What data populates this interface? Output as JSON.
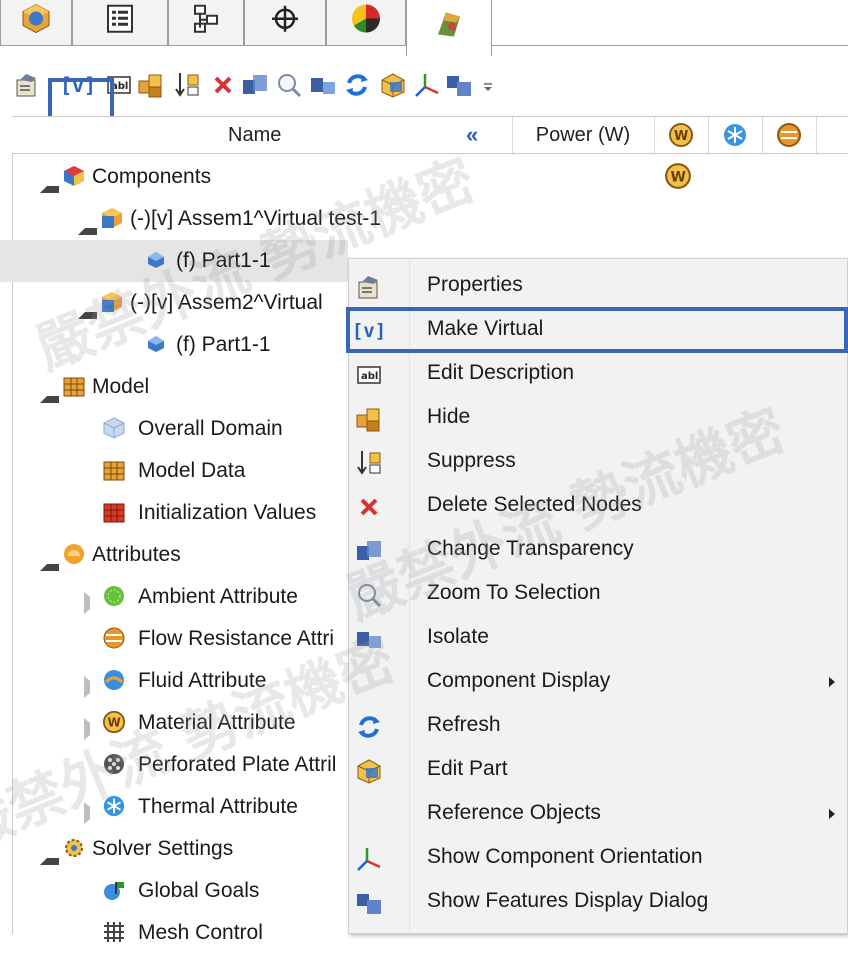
{
  "tabs": [
    {
      "icon": "component-tree-icon"
    },
    {
      "icon": "list-icon"
    },
    {
      "icon": "assembly-icon"
    },
    {
      "icon": "crosshair-icon"
    },
    {
      "icon": "pie-chart-icon"
    },
    {
      "icon": "simulation-icon"
    }
  ],
  "toolbar": {
    "icons": [
      "properties-icon",
      "make-virtual-icon",
      "edit-description-icon",
      "hide-icon",
      "suppress-icon",
      "delete-icon",
      "transparency-icon",
      "zoom-selection-icon",
      "isolate-icon",
      "refresh-icon",
      "edit-part-icon",
      "orientation-icon",
      "features-display-icon",
      "overflow-icon"
    ],
    "virtual_label": "[v]"
  },
  "header": {
    "name": "Name",
    "collapse": "«",
    "power": "Power (W)"
  },
  "tree": [
    {
      "label": "Components",
      "level": 0,
      "expanded": true
    },
    {
      "label": "(-)[v] Assem1^Virtual test-1",
      "level": 1,
      "expanded": true
    },
    {
      "label": "(f) Part1-1",
      "level": 2,
      "selected": true
    },
    {
      "label": "(-)[v] Assem2^Virtual",
      "level": 1,
      "expanded": true
    },
    {
      "label": "(f) Part1-1",
      "level": 2
    },
    {
      "label": "Model",
      "level": 0,
      "expanded": true
    },
    {
      "label": "Overall Domain",
      "level": 1
    },
    {
      "label": "Model Data",
      "level": 1
    },
    {
      "label": "Initialization Values",
      "level": 1
    },
    {
      "label": "Attributes",
      "level": 0,
      "expanded": true
    },
    {
      "label": "Ambient Attribute",
      "level": 1,
      "collapsed": true
    },
    {
      "label": "Flow Resistance Attri",
      "level": 1
    },
    {
      "label": "Fluid Attribute",
      "level": 1,
      "collapsed": true
    },
    {
      "label": "Material Attribute",
      "level": 1,
      "collapsed": true
    },
    {
      "label": "Perforated Plate Attril",
      "level": 1
    },
    {
      "label": "Thermal Attribute",
      "level": 1,
      "collapsed": true
    },
    {
      "label": "Solver Settings",
      "level": 0,
      "expanded": true
    },
    {
      "label": "Global Goals",
      "level": 1
    },
    {
      "label": "Mesh Control",
      "level": 1
    }
  ],
  "menu": [
    {
      "label": "Properties",
      "icon": "properties-icon"
    },
    {
      "label": "Make Virtual",
      "icon": "make-virtual-icon",
      "icon_text": "[v]",
      "highlighted": true
    },
    {
      "label": "Edit Description",
      "icon": "edit-description-icon",
      "icon_text": "abl"
    },
    {
      "label": "Hide",
      "icon": "hide-icon"
    },
    {
      "label": "Suppress",
      "icon": "suppress-icon"
    },
    {
      "label": "Delete Selected Nodes",
      "icon": "delete-icon"
    },
    {
      "label": "Change Transparency",
      "icon": "transparency-icon"
    },
    {
      "label": "Zoom To Selection",
      "icon": "zoom-selection-icon"
    },
    {
      "label": "Isolate",
      "icon": "isolate-icon"
    },
    {
      "label": "Component Display",
      "icon": "",
      "submenu": true
    },
    {
      "label": "Refresh",
      "icon": "refresh-icon"
    },
    {
      "label": "Edit Part",
      "icon": "edit-part-icon"
    },
    {
      "label": "Reference Objects",
      "icon": "",
      "submenu": true
    },
    {
      "label": "Show Component Orientation",
      "icon": "orientation-icon"
    },
    {
      "label": "Show Features Display Dialog",
      "icon": "features-display-icon"
    }
  ],
  "colors": {
    "highlight_border": "#3a66b8",
    "selected_row": "#e5e5e5",
    "menu_bg": "#f2f2f2"
  },
  "watermark": "嚴禁外流 勢流機密"
}
